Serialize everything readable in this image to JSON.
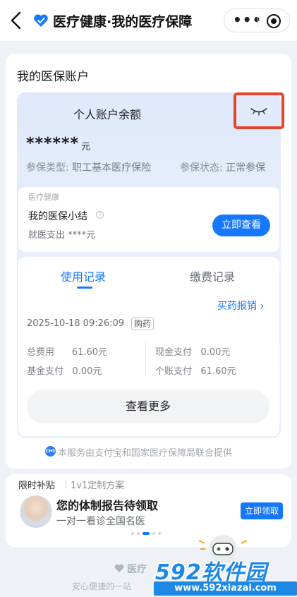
{
  "header": {
    "title": "医疗健康·我的医疗保障",
    "icons": {
      "back": "back-arrow-icon",
      "logo": "heart-logo-icon",
      "more": "more-dots-icon",
      "miniapp": "target-circle-icon"
    }
  },
  "account": {
    "section_title": "我的医保账户",
    "balance_label": "个人账户余额",
    "balance_value": "******",
    "balance_unit": "元",
    "insurance_type_label": "参保类型:",
    "insurance_type_value": "职工基本医疗保险",
    "status_label": "参保状态:",
    "status_value": "正常参保",
    "highlight_color": "#e8442a"
  },
  "summary": {
    "source": "医疗健康",
    "title": "我的医保小结",
    "subtitle": "就医支出 ****元",
    "button": "立即查看"
  },
  "records": {
    "tabs": [
      {
        "label": "使用记录",
        "active": true
      },
      {
        "label": "缴费记录",
        "active": false
      }
    ],
    "buy_link": "买药报销",
    "entry": {
      "time": "2025-10-18 09:26:09",
      "tag": "购药",
      "total_label": "总费用",
      "total_value": "61.60元",
      "cash_label": "现金支付",
      "cash_value": "0.00元",
      "fund_label": "基金支付",
      "fund_value": "0.00元",
      "personal_label": "个账支付",
      "personal_value": "61.60元"
    },
    "more_button": "查看更多"
  },
  "service_note": "本服务由支付宝和国家医疗保障局联合提供",
  "service_badge": "CHS",
  "promo": {
    "tag": "限时补贴",
    "plan": "1v1定制方案",
    "title": "您的体制报告待领取",
    "subtitle": "一对一看诊全国名医",
    "button": "立即领取",
    "dots_total": 5,
    "dots_active": 2
  },
  "bottom": {
    "brand": "医疗",
    "tagline": "安心便捷的一站"
  },
  "watermark": {
    "name": "592软件园",
    "url": "www.592xiazai.com"
  },
  "colors": {
    "accent": "#1677ff",
    "page_bg": "#eef1f6"
  }
}
